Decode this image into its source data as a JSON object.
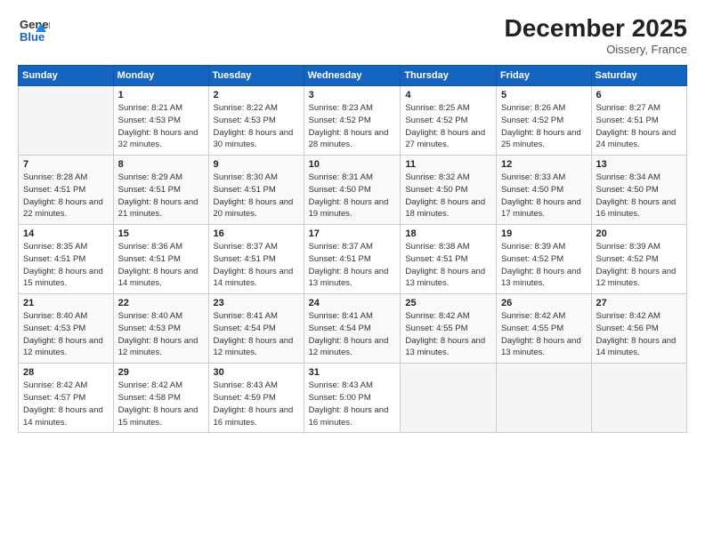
{
  "header": {
    "logo_line1": "General",
    "logo_line2": "Blue",
    "month_title": "December 2025",
    "location": "Oissery, France"
  },
  "days_of_week": [
    "Sunday",
    "Monday",
    "Tuesday",
    "Wednesday",
    "Thursday",
    "Friday",
    "Saturday"
  ],
  "weeks": [
    [
      {
        "day": "",
        "empty": true
      },
      {
        "day": "1",
        "sunrise": "Sunrise: 8:21 AM",
        "sunset": "Sunset: 4:53 PM",
        "daylight": "Daylight: 8 hours and 32 minutes."
      },
      {
        "day": "2",
        "sunrise": "Sunrise: 8:22 AM",
        "sunset": "Sunset: 4:53 PM",
        "daylight": "Daylight: 8 hours and 30 minutes."
      },
      {
        "day": "3",
        "sunrise": "Sunrise: 8:23 AM",
        "sunset": "Sunset: 4:52 PM",
        "daylight": "Daylight: 8 hours and 28 minutes."
      },
      {
        "day": "4",
        "sunrise": "Sunrise: 8:25 AM",
        "sunset": "Sunset: 4:52 PM",
        "daylight": "Daylight: 8 hours and 27 minutes."
      },
      {
        "day": "5",
        "sunrise": "Sunrise: 8:26 AM",
        "sunset": "Sunset: 4:52 PM",
        "daylight": "Daylight: 8 hours and 25 minutes."
      },
      {
        "day": "6",
        "sunrise": "Sunrise: 8:27 AM",
        "sunset": "Sunset: 4:51 PM",
        "daylight": "Daylight: 8 hours and 24 minutes."
      }
    ],
    [
      {
        "day": "7",
        "sunrise": "Sunrise: 8:28 AM",
        "sunset": "Sunset: 4:51 PM",
        "daylight": "Daylight: 8 hours and 22 minutes."
      },
      {
        "day": "8",
        "sunrise": "Sunrise: 8:29 AM",
        "sunset": "Sunset: 4:51 PM",
        "daylight": "Daylight: 8 hours and 21 minutes."
      },
      {
        "day": "9",
        "sunrise": "Sunrise: 8:30 AM",
        "sunset": "Sunset: 4:51 PM",
        "daylight": "Daylight: 8 hours and 20 minutes."
      },
      {
        "day": "10",
        "sunrise": "Sunrise: 8:31 AM",
        "sunset": "Sunset: 4:50 PM",
        "daylight": "Daylight: 8 hours and 19 minutes."
      },
      {
        "day": "11",
        "sunrise": "Sunrise: 8:32 AM",
        "sunset": "Sunset: 4:50 PM",
        "daylight": "Daylight: 8 hours and 18 minutes."
      },
      {
        "day": "12",
        "sunrise": "Sunrise: 8:33 AM",
        "sunset": "Sunset: 4:50 PM",
        "daylight": "Daylight: 8 hours and 17 minutes."
      },
      {
        "day": "13",
        "sunrise": "Sunrise: 8:34 AM",
        "sunset": "Sunset: 4:50 PM",
        "daylight": "Daylight: 8 hours and 16 minutes."
      }
    ],
    [
      {
        "day": "14",
        "sunrise": "Sunrise: 8:35 AM",
        "sunset": "Sunset: 4:51 PM",
        "daylight": "Daylight: 8 hours and 15 minutes."
      },
      {
        "day": "15",
        "sunrise": "Sunrise: 8:36 AM",
        "sunset": "Sunset: 4:51 PM",
        "daylight": "Daylight: 8 hours and 14 minutes."
      },
      {
        "day": "16",
        "sunrise": "Sunrise: 8:37 AM",
        "sunset": "Sunset: 4:51 PM",
        "daylight": "Daylight: 8 hours and 14 minutes."
      },
      {
        "day": "17",
        "sunrise": "Sunrise: 8:37 AM",
        "sunset": "Sunset: 4:51 PM",
        "daylight": "Daylight: 8 hours and 13 minutes."
      },
      {
        "day": "18",
        "sunrise": "Sunrise: 8:38 AM",
        "sunset": "Sunset: 4:51 PM",
        "daylight": "Daylight: 8 hours and 13 minutes."
      },
      {
        "day": "19",
        "sunrise": "Sunrise: 8:39 AM",
        "sunset": "Sunset: 4:52 PM",
        "daylight": "Daylight: 8 hours and 13 minutes."
      },
      {
        "day": "20",
        "sunrise": "Sunrise: 8:39 AM",
        "sunset": "Sunset: 4:52 PM",
        "daylight": "Daylight: 8 hours and 12 minutes."
      }
    ],
    [
      {
        "day": "21",
        "sunrise": "Sunrise: 8:40 AM",
        "sunset": "Sunset: 4:53 PM",
        "daylight": "Daylight: 8 hours and 12 minutes."
      },
      {
        "day": "22",
        "sunrise": "Sunrise: 8:40 AM",
        "sunset": "Sunset: 4:53 PM",
        "daylight": "Daylight: 8 hours and 12 minutes."
      },
      {
        "day": "23",
        "sunrise": "Sunrise: 8:41 AM",
        "sunset": "Sunset: 4:54 PM",
        "daylight": "Daylight: 8 hours and 12 minutes."
      },
      {
        "day": "24",
        "sunrise": "Sunrise: 8:41 AM",
        "sunset": "Sunset: 4:54 PM",
        "daylight": "Daylight: 8 hours and 12 minutes."
      },
      {
        "day": "25",
        "sunrise": "Sunrise: 8:42 AM",
        "sunset": "Sunset: 4:55 PM",
        "daylight": "Daylight: 8 hours and 13 minutes."
      },
      {
        "day": "26",
        "sunrise": "Sunrise: 8:42 AM",
        "sunset": "Sunset: 4:55 PM",
        "daylight": "Daylight: 8 hours and 13 minutes."
      },
      {
        "day": "27",
        "sunrise": "Sunrise: 8:42 AM",
        "sunset": "Sunset: 4:56 PM",
        "daylight": "Daylight: 8 hours and 14 minutes."
      }
    ],
    [
      {
        "day": "28",
        "sunrise": "Sunrise: 8:42 AM",
        "sunset": "Sunset: 4:57 PM",
        "daylight": "Daylight: 8 hours and 14 minutes."
      },
      {
        "day": "29",
        "sunrise": "Sunrise: 8:42 AM",
        "sunset": "Sunset: 4:58 PM",
        "daylight": "Daylight: 8 hours and 15 minutes."
      },
      {
        "day": "30",
        "sunrise": "Sunrise: 8:43 AM",
        "sunset": "Sunset: 4:59 PM",
        "daylight": "Daylight: 8 hours and 16 minutes."
      },
      {
        "day": "31",
        "sunrise": "Sunrise: 8:43 AM",
        "sunset": "Sunset: 5:00 PM",
        "daylight": "Daylight: 8 hours and 16 minutes."
      },
      {
        "day": "",
        "empty": true
      },
      {
        "day": "",
        "empty": true
      },
      {
        "day": "",
        "empty": true
      }
    ]
  ]
}
